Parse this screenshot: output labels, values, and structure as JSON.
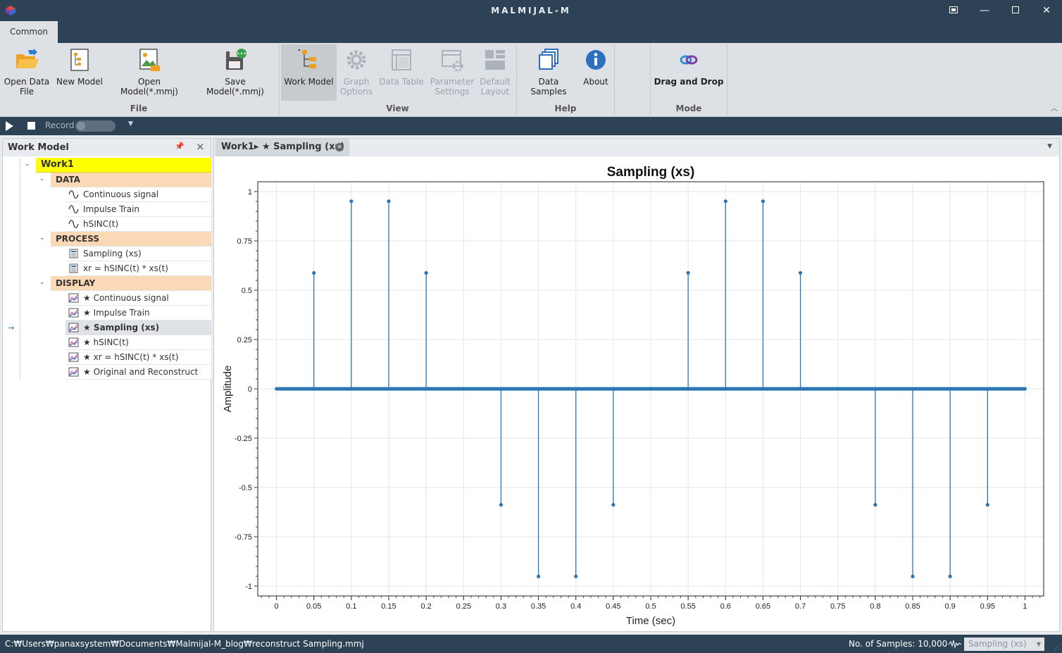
{
  "window": {
    "title": "MALMIJAL-M",
    "buttons": [
      "restore-layout",
      "minimize",
      "maximize",
      "close"
    ]
  },
  "ribbon": {
    "tab": "Common",
    "groups": {
      "file": {
        "label": "File",
        "buttons": [
          {
            "label": "Open Data\nFile",
            "icon": "open-folder-icon"
          },
          {
            "label": "New Model",
            "icon": "new-model-icon"
          },
          {
            "label": "Open Model(*.mmj)",
            "icon": "open-model-icon"
          },
          {
            "label": "Save Model(*.mmj)",
            "icon": "save-model-icon"
          }
        ]
      },
      "view": {
        "label": "View",
        "buttons": [
          {
            "label": "Work Model",
            "icon": "work-model-icon",
            "active": true
          },
          {
            "label": "Graph\nOptions",
            "icon": "gear-icon",
            "disabled": true
          },
          {
            "label": "Data Table",
            "icon": "table-icon",
            "disabled": true
          },
          {
            "label": "Parameter\nSettings",
            "icon": "parameter-icon",
            "disabled": true
          },
          {
            "label": "Default\nLayout",
            "icon": "layout-icon",
            "disabled": true
          }
        ]
      },
      "help": {
        "label": "Help",
        "buttons": [
          {
            "label": "Data Samples",
            "icon": "samples-icon"
          },
          {
            "label": "About",
            "icon": "info-icon"
          }
        ]
      },
      "mode": {
        "label": "Mode",
        "buttons": [
          {
            "label": "Drag and Drop",
            "icon": "drag-drop-icon"
          }
        ]
      }
    }
  },
  "recordbar": {
    "record_label": "Record"
  },
  "work_model_panel": {
    "title": "Work Model",
    "root": "Work1",
    "categories": [
      {
        "label": "DATA",
        "items": [
          "Continuous signal",
          "Impulse Train",
          "hSINC(t)"
        ]
      },
      {
        "label": "PROCESS",
        "items": [
          "Sampling (xs)",
          "xr = hSINC(t) * xs(t)"
        ]
      },
      {
        "label": "DISPLAY",
        "items": [
          "★ Continuous signal",
          "★ Impulse Train",
          "★ Sampling (xs)",
          "★ hSINC(t)",
          "★ xr = hSINC(t) * xs(t)",
          "★ Original and Reconstruct"
        ]
      }
    ],
    "selected": "★ Sampling (xs)"
  },
  "document": {
    "tab_label": "Work1▸ ★ Sampling (xs)"
  },
  "chart_data": {
    "type": "stem",
    "title": "Sampling (xs)",
    "xlabel": "Time (sec)",
    "ylabel": "Amplitude",
    "xlim": [
      -0.025,
      1.025
    ],
    "ylim": [
      -1.05,
      1.05
    ],
    "xticks": [
      "0",
      "0.05",
      "0.1",
      "0.15",
      "0.2",
      "0.25",
      "0.3",
      "0.35",
      "0.4",
      "0.45",
      "0.5",
      "0.55",
      "0.6",
      "0.65",
      "0.7",
      "0.75",
      "0.8",
      "0.85",
      "0.9",
      "0.95",
      "1"
    ],
    "yticks": [
      "1",
      "0.75",
      "0.5",
      "0.25",
      "0",
      "-0.25",
      "-0.5",
      "-0.75",
      "-1"
    ],
    "grid": true,
    "color": "#2b75b3",
    "stems": [
      {
        "x": 0.05,
        "y": 0.588
      },
      {
        "x": 0.1,
        "y": 0.951
      },
      {
        "x": 0.15,
        "y": 0.951
      },
      {
        "x": 0.2,
        "y": 0.588
      },
      {
        "x": 0.3,
        "y": -0.588
      },
      {
        "x": 0.35,
        "y": -0.951
      },
      {
        "x": 0.4,
        "y": -0.951
      },
      {
        "x": 0.45,
        "y": -0.588
      },
      {
        "x": 0.55,
        "y": 0.588
      },
      {
        "x": 0.6,
        "y": 0.951
      },
      {
        "x": 0.65,
        "y": 0.951
      },
      {
        "x": 0.7,
        "y": 0.588
      },
      {
        "x": 0.8,
        "y": -0.588
      },
      {
        "x": 0.85,
        "y": -0.951
      },
      {
        "x": 0.9,
        "y": -0.951
      },
      {
        "x": 0.95,
        "y": -0.588
      }
    ],
    "zero_line": {
      "x_start": 0,
      "x_end": 1
    }
  },
  "statusbar": {
    "path": "C:₩Users₩panaxsystem₩Documents₩Malmijal-M_blog₩reconstruct Sampling.mmj",
    "samples": "No. of Samples: 10,000",
    "selector": "Sampling (xs)"
  }
}
